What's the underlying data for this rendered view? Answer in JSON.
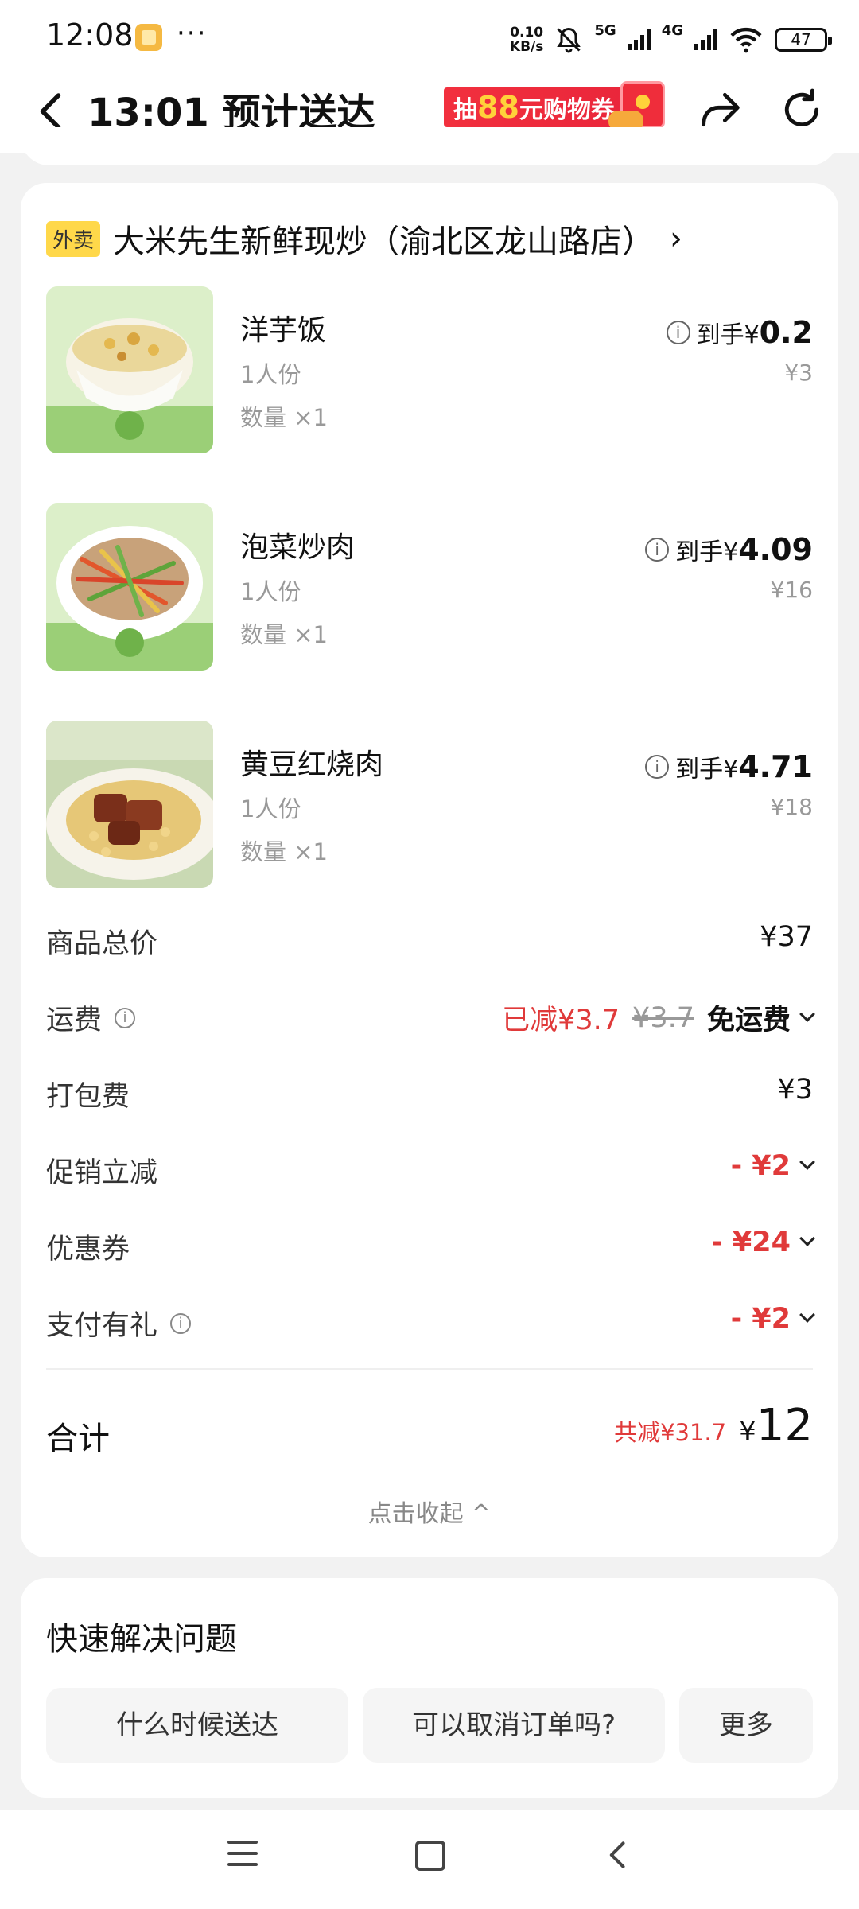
{
  "status_bar": {
    "time": "12:08",
    "dots": "···",
    "speed": "0.10",
    "speed_unit": "KB/s",
    "net1": "5G",
    "net2": "4G",
    "battery": "47"
  },
  "header": {
    "title": "13:01 预计送达",
    "promo_prefix": "抽",
    "promo_amount": "88",
    "promo_suffix": "元购物券"
  },
  "store": {
    "badge": "外卖",
    "name": "大米先生新鲜现炒（渝北区龙山路店）",
    "chevron": "›"
  },
  "items": [
    {
      "name": "洋芋饭",
      "portion": "1人份",
      "qty": "数量 ×1",
      "price_prefix": "到手¥",
      "price": "0.2",
      "original": "¥3"
    },
    {
      "name": "泡菜炒肉",
      "portion": "1人份",
      "qty": "数量 ×1",
      "price_prefix": "到手¥",
      "price": "4.09",
      "original": "¥16"
    },
    {
      "name": "黄豆红烧肉",
      "portion": "1人份",
      "qty": "数量 ×1",
      "price_prefix": "到手¥",
      "price": "4.71",
      "original": "¥18"
    }
  ],
  "summary": {
    "goods_total": {
      "label": "商品总价",
      "value": "¥37"
    },
    "delivery": {
      "label": "运费",
      "reduced": "已减¥3.7",
      "original": "¥3.7",
      "value": "免运费"
    },
    "packing": {
      "label": "打包费",
      "value": "¥3"
    },
    "promo": {
      "label": "促销立减",
      "value": "- ¥2"
    },
    "coupon": {
      "label": "优惠券",
      "value": "- ¥24"
    },
    "pay_gift": {
      "label": "支付有礼",
      "value": "- ¥2"
    }
  },
  "total": {
    "label": "合计",
    "saved": "共减¥31.7",
    "currency": "¥",
    "amount": "12",
    "collapse": "点击收起 ^"
  },
  "quick": {
    "title": "快速解决问题",
    "buttons": [
      "什么时候送达",
      "可以取消订单吗?",
      "更多"
    ]
  },
  "colors": {
    "accent_red": "#e03a3a",
    "badge_yellow": "#ffd84a",
    "promo_red": "#f2303e"
  }
}
